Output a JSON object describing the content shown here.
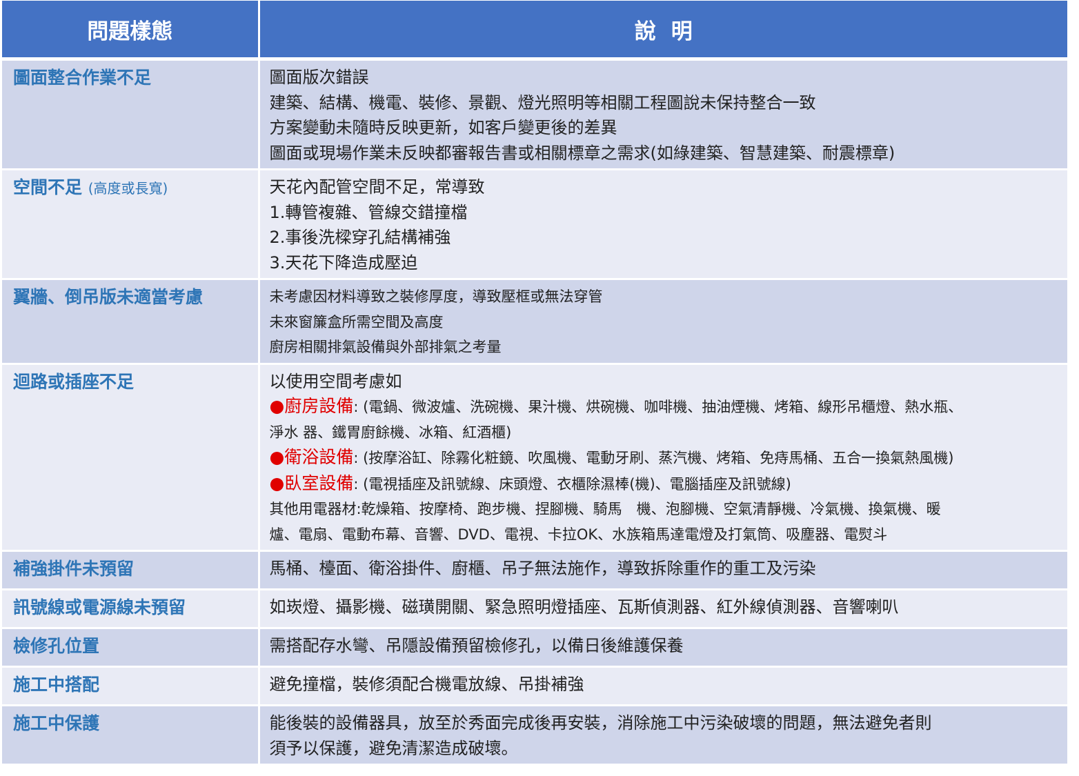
{
  "header": {
    "col1": "問題樣態",
    "col2": "說明"
  },
  "rows": [
    {
      "issue": "圖面整合作業不足",
      "lines": [
        "圖面版次錯誤",
        "建築、結構、機電、裝修、景觀、燈光照明等相關工程圖說未保持整合一致",
        "方案變動未隨時反映更新，如客戶變更後的差異",
        "圖面或現場作業未反映都審報告書或相關標章之需求(如綠建築、智慧建築、耐震標章)"
      ]
    },
    {
      "issue": "空間不足",
      "issue_note": "(高度或長寬)",
      "lines": [
        "天花內配管空間不足，常導致",
        "1.轉管複雜、管線交錯撞檔",
        "2.事後洗樑穿孔結構補強",
        "3.天花下降造成壓迫"
      ]
    },
    {
      "issue": "翼牆、倒吊版未適當考慮",
      "lines": [
        "未考慮因材料導致之裝修厚度，導致壓框或無法穿管",
        "未來窗簾盒所需空間及高度",
        "廚房相關排氣設備與外部排氣之考量"
      ]
    },
    {
      "issue": "迴路或插座不足",
      "intro": "以使用空間考慮如",
      "bullet_symbol": "●",
      "groups": [
        {
          "label": "廚房設備",
          "items": ": (電鍋、微波爐、洗碗機、果汁機、烘碗機、咖啡機、抽油煙機、烤箱、線形吊櫃燈、熱水瓶、",
          "items_cont": "淨水 器、鐵胃廚餘機、冰箱、紅酒櫃)"
        },
        {
          "label": "衛浴設備",
          "items": ": (按摩浴缸、除霧化粧鏡、吹風機、電動牙刷、蒸汽機、烤箱、免痔馬桶、五合一換氣熱風機)"
        },
        {
          "label": "臥室設備",
          "items": ": (電視插座及訊號線、床頭燈、衣櫃除濕棒(機)、電腦插座及訊號線)"
        }
      ],
      "other_line1": "其他用電器材:乾燥箱、按摩椅、跑步機、捏腳機、騎馬　機、泡腳機、空氣清靜機、冷氣機、換氣機、暖",
      "other_line2": "爐、電扇、電動布幕、音響、DVD、電視、卡拉OK、水族箱馬達電燈及打氣筒、吸塵器、電熨斗"
    },
    {
      "issue": "補強掛件未預留",
      "lines": [
        "馬桶、檯面、衛浴掛件、廚櫃、吊子無法施作，導致拆除重作的重工及污染"
      ]
    },
    {
      "issue": "訊號線或電源線未預留",
      "lines": [
        "如崁燈、攝影機、磁璜開關、緊急照明燈插座、瓦斯偵測器、紅外線偵測器、音響喇叭"
      ]
    },
    {
      "issue": "檢修孔位置",
      "lines": [
        "需搭配存水彎、吊隱設備預留檢修孔，以備日後維護保養"
      ]
    },
    {
      "issue": "施工中搭配",
      "lines": [
        "避免撞檔，裝修須配合機電放線、吊掛補強"
      ]
    },
    {
      "issue": "施工中保護",
      "lines": [
        "能後裝的設備器具，放至於秀面完成後再安裝，消除施工中污染破壞的問題，無法避免者則",
        "須予以保護，避免清潔造成破壞。"
      ]
    }
  ],
  "colors": {
    "header_bg": "#4472c4",
    "row_dark": "#cfd5ea",
    "row_light": "#e9ebf5",
    "issue_text": "#2e75b6",
    "bullet_red": "#e00000"
  }
}
